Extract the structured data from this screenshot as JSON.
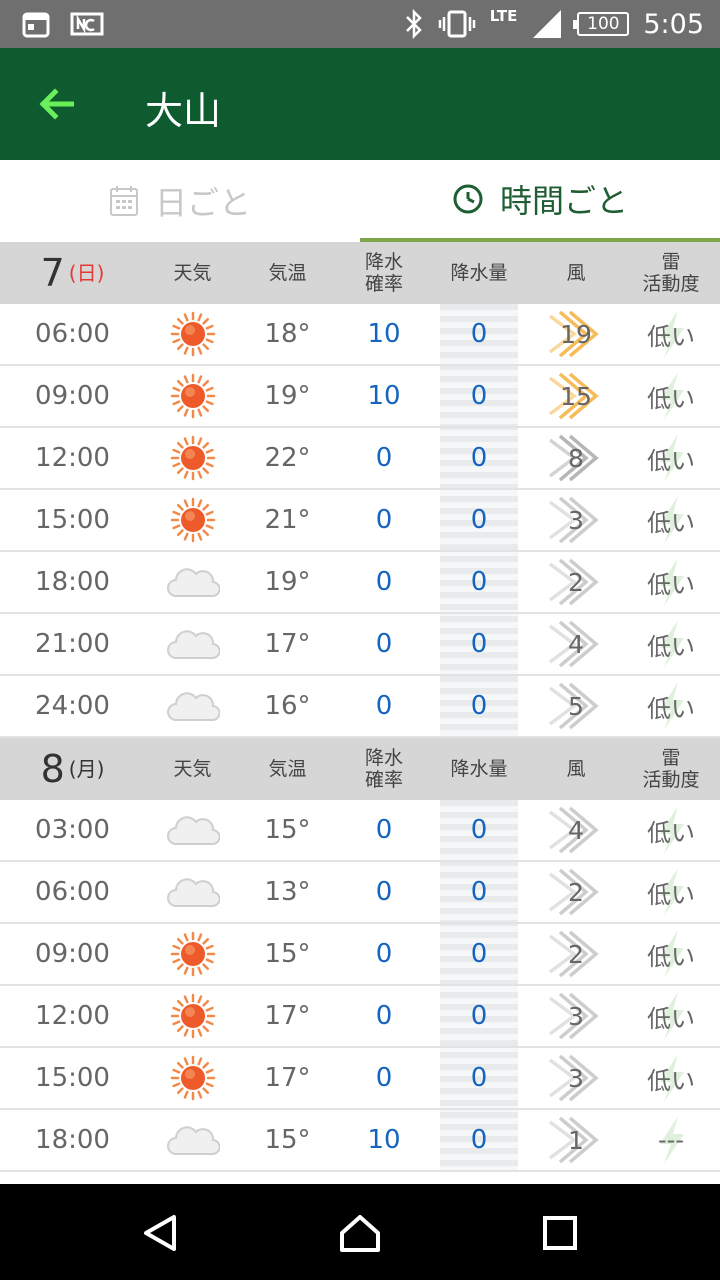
{
  "status_bar": {
    "time": "5:05",
    "network": "LTE",
    "battery": "100",
    "icons": [
      "calendar-icon",
      "nfc-icon",
      "bluetooth-icon",
      "vibrate-icon",
      "signal-icon",
      "battery-icon"
    ]
  },
  "app_bar": {
    "title": "大山",
    "back_icon": "back-arrow-icon",
    "colors": {
      "bar": "#0e5b2f",
      "back_arrow": "#6cf05a"
    }
  },
  "tabs": [
    {
      "label": "日ごと",
      "icon": "calendar-icon",
      "selected": false
    },
    {
      "label": "時間ごと",
      "icon": "clock-icon",
      "selected": true
    }
  ],
  "headers": {
    "weather": "天気",
    "temp": "気温",
    "pop_line1": "降水",
    "pop_line2": "確率",
    "rain": "降水量",
    "wind": "風",
    "thunder_line1": "雷",
    "thunder_line2": "活動度"
  },
  "days": [
    {
      "date": "7",
      "dow": "(日)",
      "rows": [
        {
          "time": "06:00",
          "weather": "sunny",
          "temp": "18°",
          "pop": "10",
          "rain": "0",
          "wind": "19",
          "wind_color": "#f5a623",
          "thunder": "低い"
        },
        {
          "time": "09:00",
          "weather": "sunny",
          "temp": "19°",
          "pop": "10",
          "rain": "0",
          "wind": "15",
          "wind_color": "#f5a623",
          "thunder": "低い"
        },
        {
          "time": "12:00",
          "weather": "sunny",
          "temp": "22°",
          "pop": "0",
          "rain": "0",
          "wind": "8",
          "wind_color": "#9e9e9e",
          "thunder": "低い"
        },
        {
          "time": "15:00",
          "weather": "sunny",
          "temp": "21°",
          "pop": "0",
          "rain": "0",
          "wind": "3",
          "wind_color": "#bdbdbd",
          "thunder": "低い"
        },
        {
          "time": "18:00",
          "weather": "cloudy",
          "temp": "19°",
          "pop": "0",
          "rain": "0",
          "wind": "2",
          "wind_color": "#bdbdbd",
          "thunder": "低い"
        },
        {
          "time": "21:00",
          "weather": "cloudy",
          "temp": "17°",
          "pop": "0",
          "rain": "0",
          "wind": "4",
          "wind_color": "#bdbdbd",
          "thunder": "低い"
        },
        {
          "time": "24:00",
          "weather": "cloudy",
          "temp": "16°",
          "pop": "0",
          "rain": "0",
          "wind": "5",
          "wind_color": "#bdbdbd",
          "thunder": "低い"
        }
      ]
    },
    {
      "date": "8",
      "dow": "(月)",
      "rows": [
        {
          "time": "03:00",
          "weather": "cloudy",
          "temp": "15°",
          "pop": "0",
          "rain": "0",
          "wind": "4",
          "wind_color": "#bdbdbd",
          "thunder": "低い"
        },
        {
          "time": "06:00",
          "weather": "cloudy",
          "temp": "13°",
          "pop": "0",
          "rain": "0",
          "wind": "2",
          "wind_color": "#bdbdbd",
          "thunder": "低い"
        },
        {
          "time": "09:00",
          "weather": "sunny",
          "temp": "15°",
          "pop": "0",
          "rain": "0",
          "wind": "2",
          "wind_color": "#bdbdbd",
          "thunder": "低い"
        },
        {
          "time": "12:00",
          "weather": "sunny",
          "temp": "17°",
          "pop": "0",
          "rain": "0",
          "wind": "3",
          "wind_color": "#bdbdbd",
          "thunder": "低い"
        },
        {
          "time": "15:00",
          "weather": "sunny",
          "temp": "17°",
          "pop": "0",
          "rain": "0",
          "wind": "3",
          "wind_color": "#bdbdbd",
          "thunder": "低い"
        },
        {
          "time": "18:00",
          "weather": "cloudy",
          "temp": "15°",
          "pop": "10",
          "rain": "0",
          "wind": "1",
          "wind_color": "#bdbdbd",
          "thunder": "---"
        }
      ]
    }
  ],
  "nav_bar": {
    "icons": [
      "back-triangle-icon",
      "home-icon",
      "recents-icon"
    ]
  }
}
